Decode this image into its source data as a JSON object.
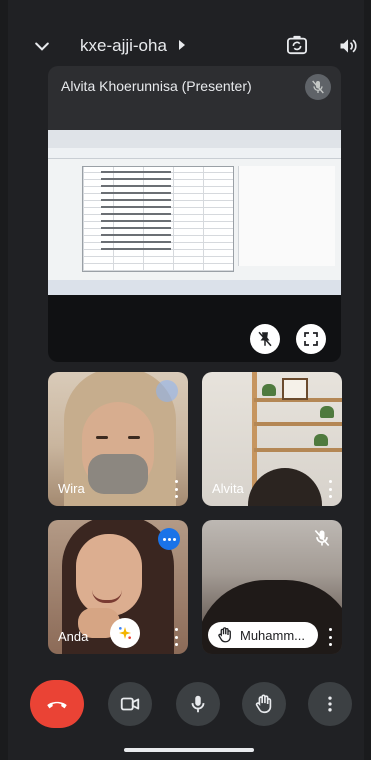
{
  "meeting": {
    "code": "kxe-ajji-oha",
    "icons": {
      "back": "chevron-down-icon",
      "title_caret": "caret-right-icon",
      "switch_camera": "camera-switch-icon",
      "audio_output": "speaker-icon"
    }
  },
  "presenter": {
    "name": "Alvita Khoerunnisa (Presenter)",
    "muted": true,
    "content": "shared spreadsheet screen",
    "controls": {
      "pin": "unpin-icon",
      "fullscreen": "fullscreen-icon"
    }
  },
  "participants": [
    {
      "name": "Wira"
    },
    {
      "name": "Alvita"
    },
    {
      "name": "Anda"
    },
    {
      "name": "Muhamm...",
      "hand_raised": true,
      "muted": true
    }
  ],
  "controls": {
    "end_call": "end-call-icon",
    "camera": "video-icon",
    "microphone": "mic-icon",
    "raise_hand": "hand-icon",
    "more": "more-vert-icon"
  },
  "colors": {
    "background": "#202124",
    "tile": "#3c4043",
    "end_call": "#ea4335",
    "accent_blue": "#1a73e8"
  }
}
